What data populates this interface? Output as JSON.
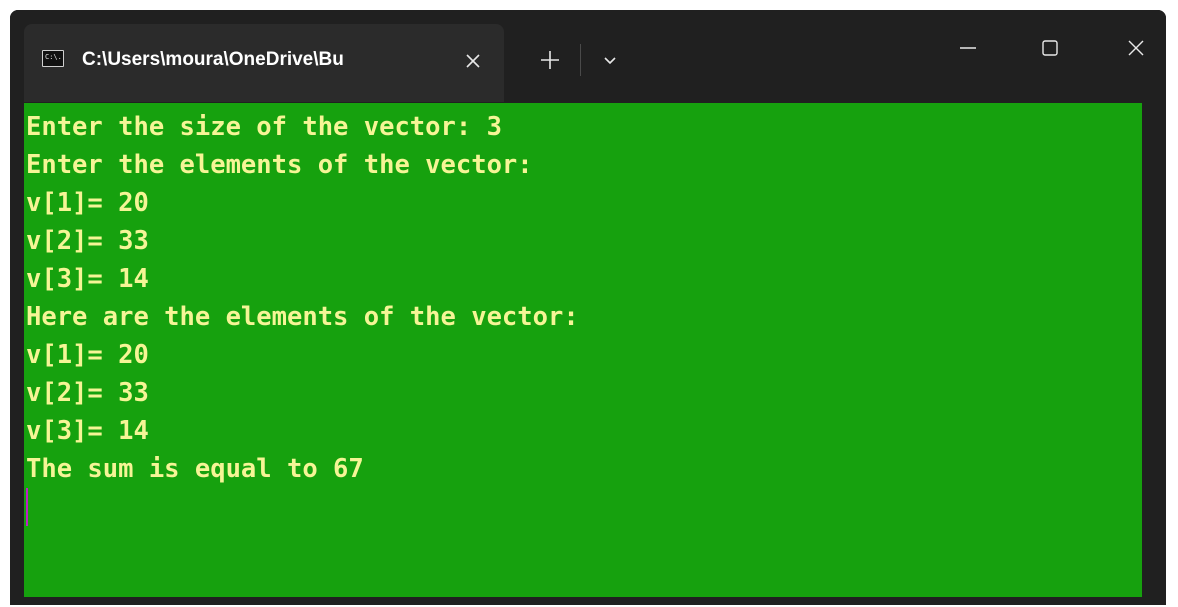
{
  "tab": {
    "icon": "terminal-icon",
    "icon_text": "C:\\.",
    "title": "C:\\Users\\moura\\OneDrive\\Bu"
  },
  "colors": {
    "console_background": "#16a10e",
    "console_text": "#f5f596",
    "titlebar": "#202020",
    "cursor": "#c020c8"
  },
  "console": {
    "lines": [
      "Enter the size of the vector: 3",
      "Enter the elements of the vector:",
      "v[1]= 20",
      "v[2]= 33",
      "v[3]= 14",
      "Here are the elements of the vector:",
      "v[1]= 20",
      "v[2]= 33",
      "v[3]= 14",
      "The sum is equal to 67"
    ]
  },
  "icons": {
    "tab_close": "close-icon",
    "new_tab": "plus-icon",
    "dropdown": "chevron-down-icon",
    "minimize": "minimize-icon",
    "maximize": "maximize-icon",
    "close": "close-icon"
  }
}
